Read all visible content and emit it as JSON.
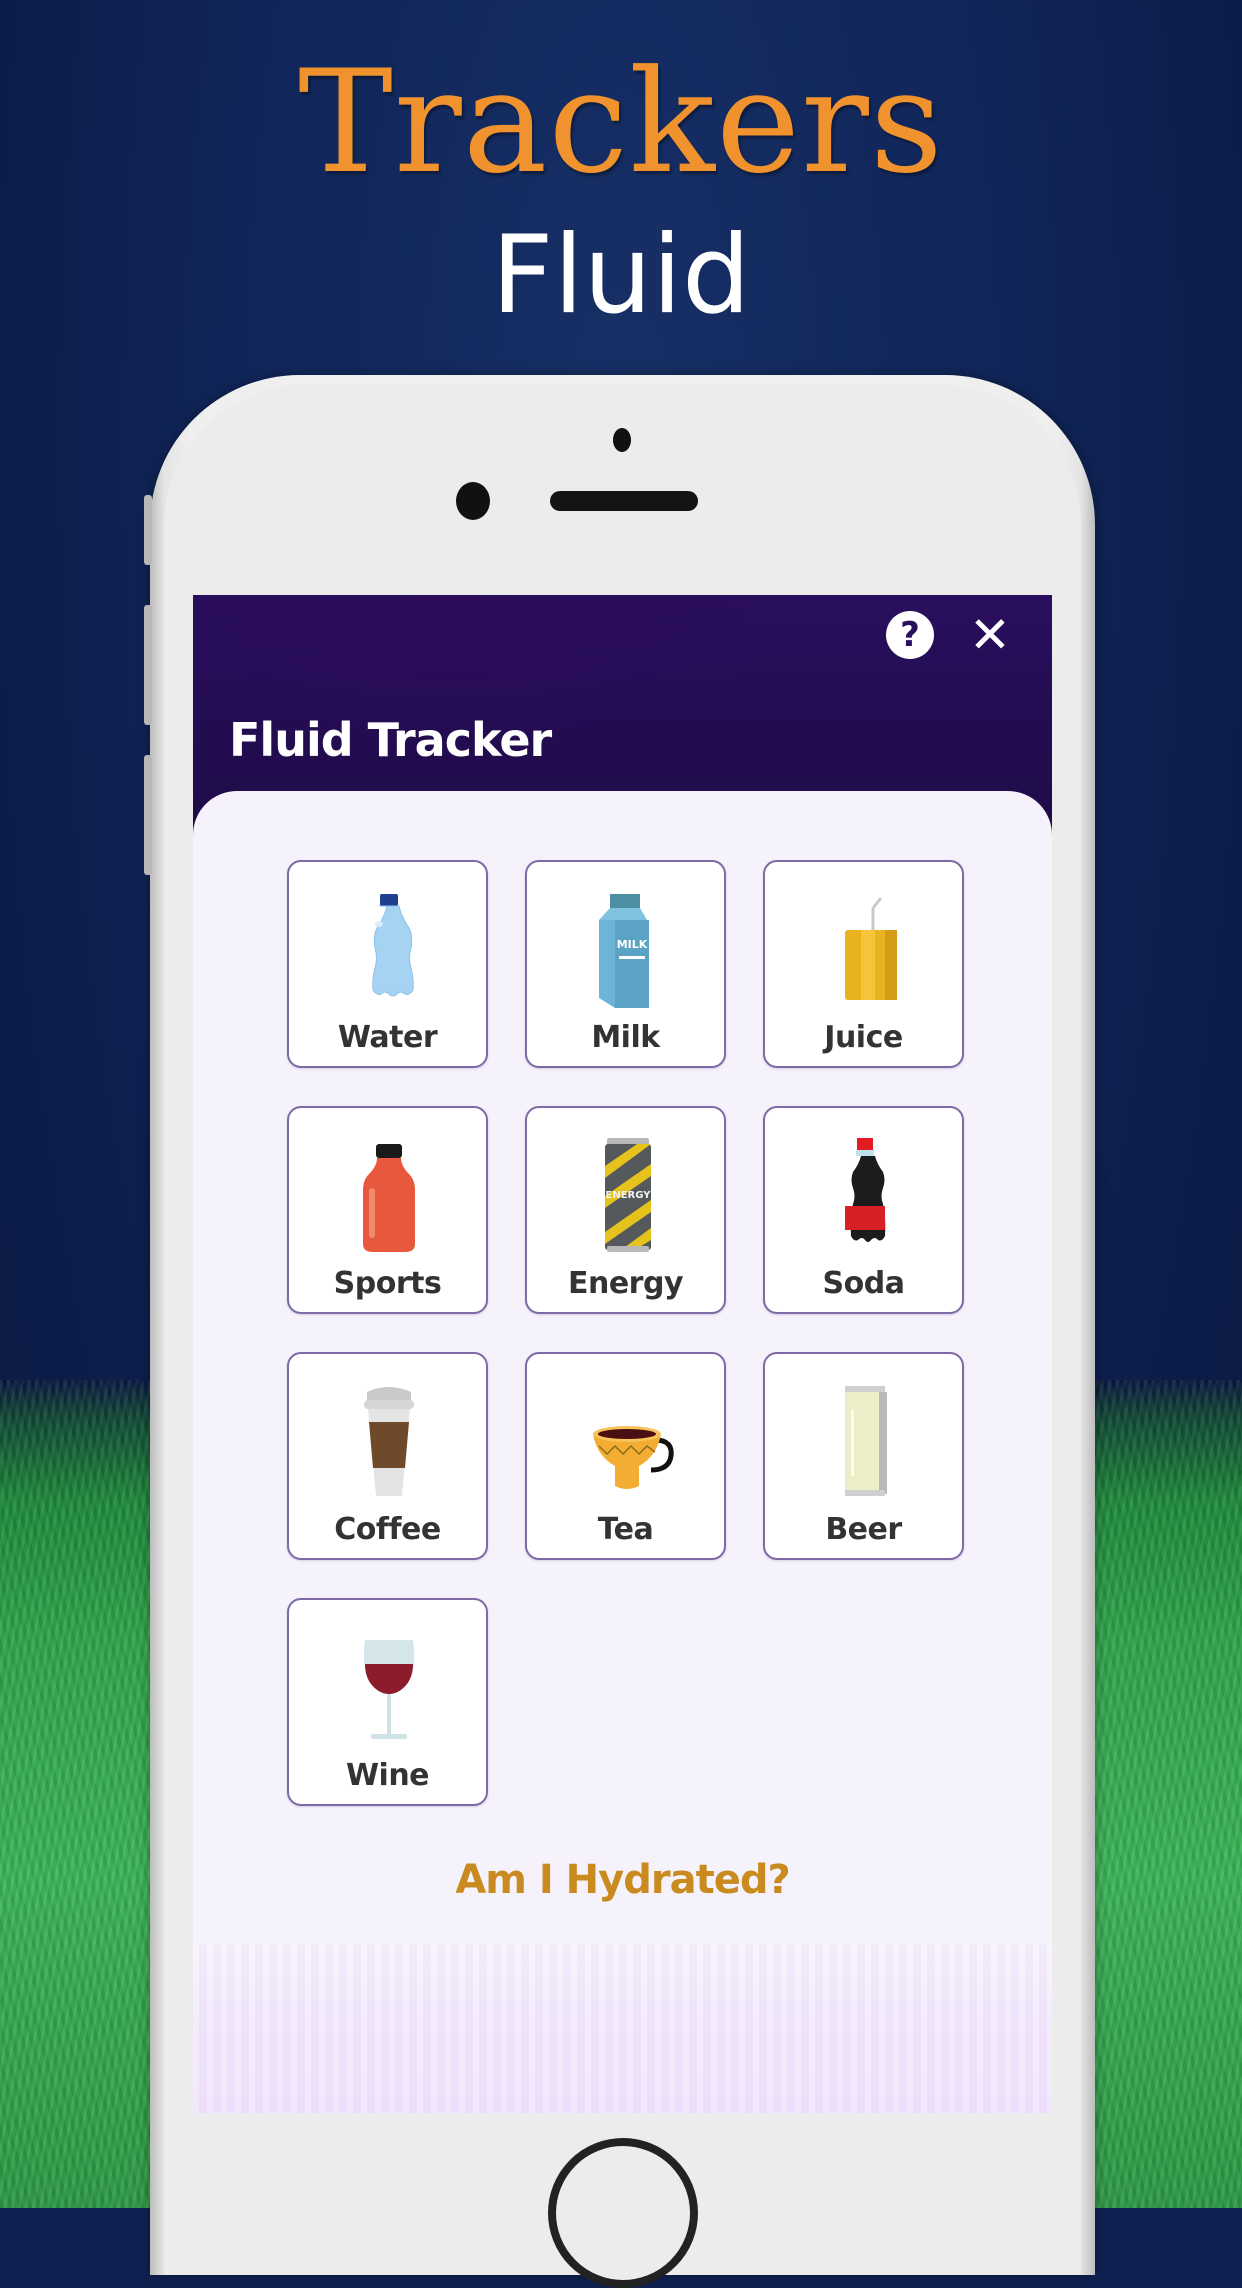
{
  "promo": {
    "headline": "Trackers",
    "subheadline": "Fluid"
  },
  "app": {
    "title": "Fluid Tracker",
    "help_icon": "?",
    "close_icon": "✕",
    "colors": {
      "header": "#2a0f5e",
      "accent": "#c98a1f",
      "tile_border": "#7d6aa6"
    }
  },
  "drinks": [
    {
      "label": "Water",
      "icon": "water-bottle-icon"
    },
    {
      "label": "Milk",
      "icon": "milk-carton-icon",
      "icon_text": "MILK"
    },
    {
      "label": "Juice",
      "icon": "juice-box-icon"
    },
    {
      "label": "Sports",
      "icon": "sports-bottle-icon"
    },
    {
      "label": "Energy",
      "icon": "energy-can-icon",
      "icon_text": "ENERGY"
    },
    {
      "label": "Soda",
      "icon": "soda-bottle-icon"
    },
    {
      "label": "Coffee",
      "icon": "coffee-cup-icon"
    },
    {
      "label": "Tea",
      "icon": "tea-cup-icon"
    },
    {
      "label": "Beer",
      "icon": "beer-can-icon"
    },
    {
      "label": "Wine",
      "icon": "wine-glass-icon"
    }
  ],
  "footer": {
    "hydration_link": "Am I Hydrated?"
  }
}
